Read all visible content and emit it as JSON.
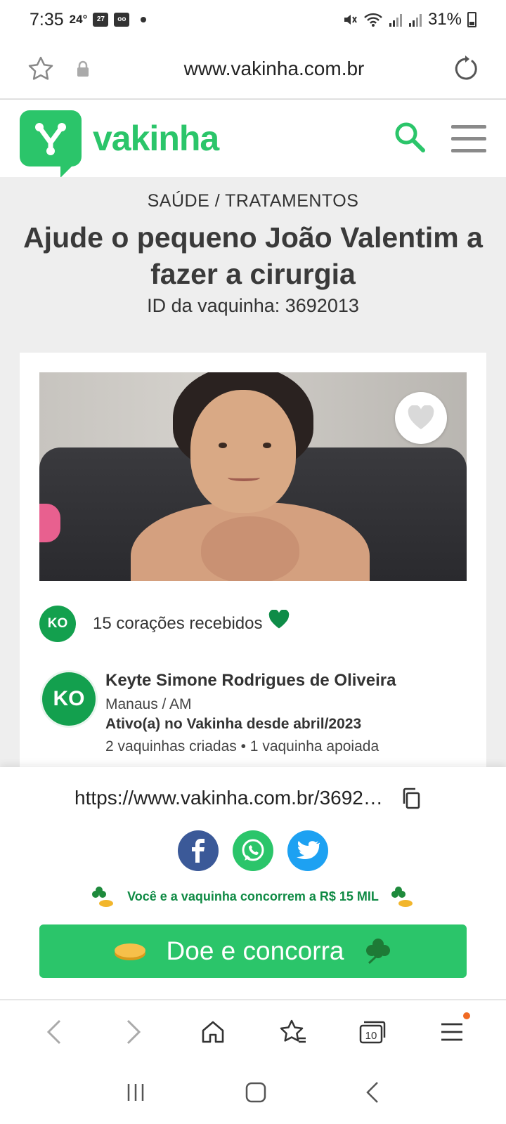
{
  "status_bar": {
    "time": "7:35",
    "temperature": "24°",
    "calendar_day": "27",
    "battery_percent": "31%"
  },
  "browser": {
    "url": "www.vakinha.com.br"
  },
  "site": {
    "brand": "vakinha",
    "brand_color": "#2bc56a"
  },
  "campaign": {
    "category": "SAÚDE / TRATAMENTOS",
    "title": "Ajude o pequeno João Valentim a fazer a cirurgia",
    "id_text": "ID da vaquinha: 3692013",
    "hearts_avatar": "KO",
    "hearts_text": "15 corações recebidos"
  },
  "owner": {
    "initials": "KO",
    "name": "Keyte Simone Rodrigues de Oliveira",
    "location": "Manaus / AM",
    "since": "Ativo(a) no Vakinha desde abril/2023",
    "stats": "2 vaquinhas criadas  •  1 vaquinha apoiada"
  },
  "share": {
    "url": "https://www.vakinha.com.br/3692013",
    "promo_text": "Você e a vaquinha concorrem a R$ 15 MIL",
    "donate_label": "Doe e concorra"
  },
  "browser_nav": {
    "tabs_count": "10"
  }
}
